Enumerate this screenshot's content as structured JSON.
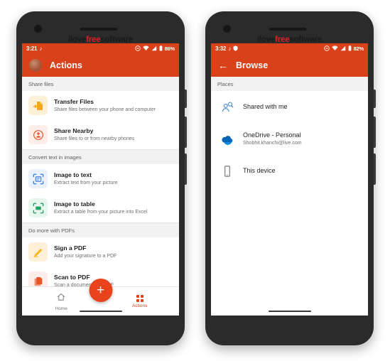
{
  "watermark": {
    "part1": "ilove",
    "part2": "free",
    "part3": "software"
  },
  "colors": {
    "accent_orange": "#D9411A",
    "fab_orange": "#E8431C",
    "watermark_red": "#d81f26",
    "section_bg": "#f2f2f2"
  },
  "phone_left": {
    "statusbar": {
      "time": "3:21",
      "music_icon": "music-note-icon",
      "cast_icon": "cast-icon",
      "wifi_icon": "wifi-icon",
      "signal_icon": "signal-icon",
      "battery_icon": "battery-icon",
      "battery_text": "86%"
    },
    "appbar": {
      "avatar": "avatar",
      "title": "Actions"
    },
    "sections": [
      {
        "header": "Share files",
        "items": [
          {
            "icon": "file-transfer-icon",
            "tile_bg": "#FDF0D8",
            "icon_color": "#F5A623",
            "title": "Transfer Files",
            "subtitle": "Share files between your phone and computer"
          },
          {
            "icon": "share-nearby-icon",
            "tile_bg": "#FDEEE9",
            "icon_color": "#E8542A",
            "title": "Share Nearby",
            "subtitle": "Share files to or from nearby phones"
          }
        ]
      },
      {
        "header": "Convert text in images",
        "items": [
          {
            "icon": "image-to-text-scan-icon",
            "tile_bg": "#EAF2FD",
            "icon_color": "#3B82E6",
            "title": "Image to text",
            "subtitle": "Extract text from your picture"
          },
          {
            "icon": "image-to-table-scan-icon",
            "tile_bg": "#E8F7EE",
            "icon_color": "#21A366",
            "title": "Image to table",
            "subtitle": "Extract a table from your picture into Excel"
          }
        ]
      },
      {
        "header": "Do more with PDFs",
        "items": [
          {
            "icon": "pencil-sign-icon",
            "tile_bg": "#FDF0D8",
            "icon_color": "#F5B927",
            "title": "Sign a PDF",
            "subtitle": "Add your signature to a PDF"
          },
          {
            "icon": "scan-to-pdf-icon",
            "tile_bg": "#FDEDE9",
            "icon_color": "#E8542A",
            "title": "Scan to PDF",
            "subtitle": "Scan a document to a PDF"
          }
        ]
      }
    ],
    "bottom_nav": {
      "items": [
        {
          "icon": "home-icon",
          "label": "Home",
          "active": false
        },
        {
          "icon": "grid-dots-icon",
          "label": "Actions",
          "active": true
        }
      ],
      "fab": {
        "icon": "plus-icon",
        "label": "+"
      }
    }
  },
  "phone_right": {
    "statusbar": {
      "time": "3:32",
      "music_icon": "music-note-icon",
      "shield_icon": "shield-icon",
      "cast_icon": "cast-icon",
      "wifi_icon": "wifi-icon",
      "signal_icon": "signal-icon",
      "battery_icon": "battery-icon",
      "battery_text": "82%"
    },
    "appbar": {
      "back_icon": "back-arrow-icon",
      "title": "Browse"
    },
    "section_header": "Places",
    "places": [
      {
        "icon": "shared-with-me-person-icon",
        "title": "Shared with me",
        "subtitle": ""
      },
      {
        "icon": "onedrive-cloud-icon",
        "title": "OneDrive - Personal",
        "subtitle": "Shobhit.khanchi@live.com"
      },
      {
        "icon": "this-device-phone-icon",
        "title": "This device",
        "subtitle": ""
      }
    ]
  }
}
